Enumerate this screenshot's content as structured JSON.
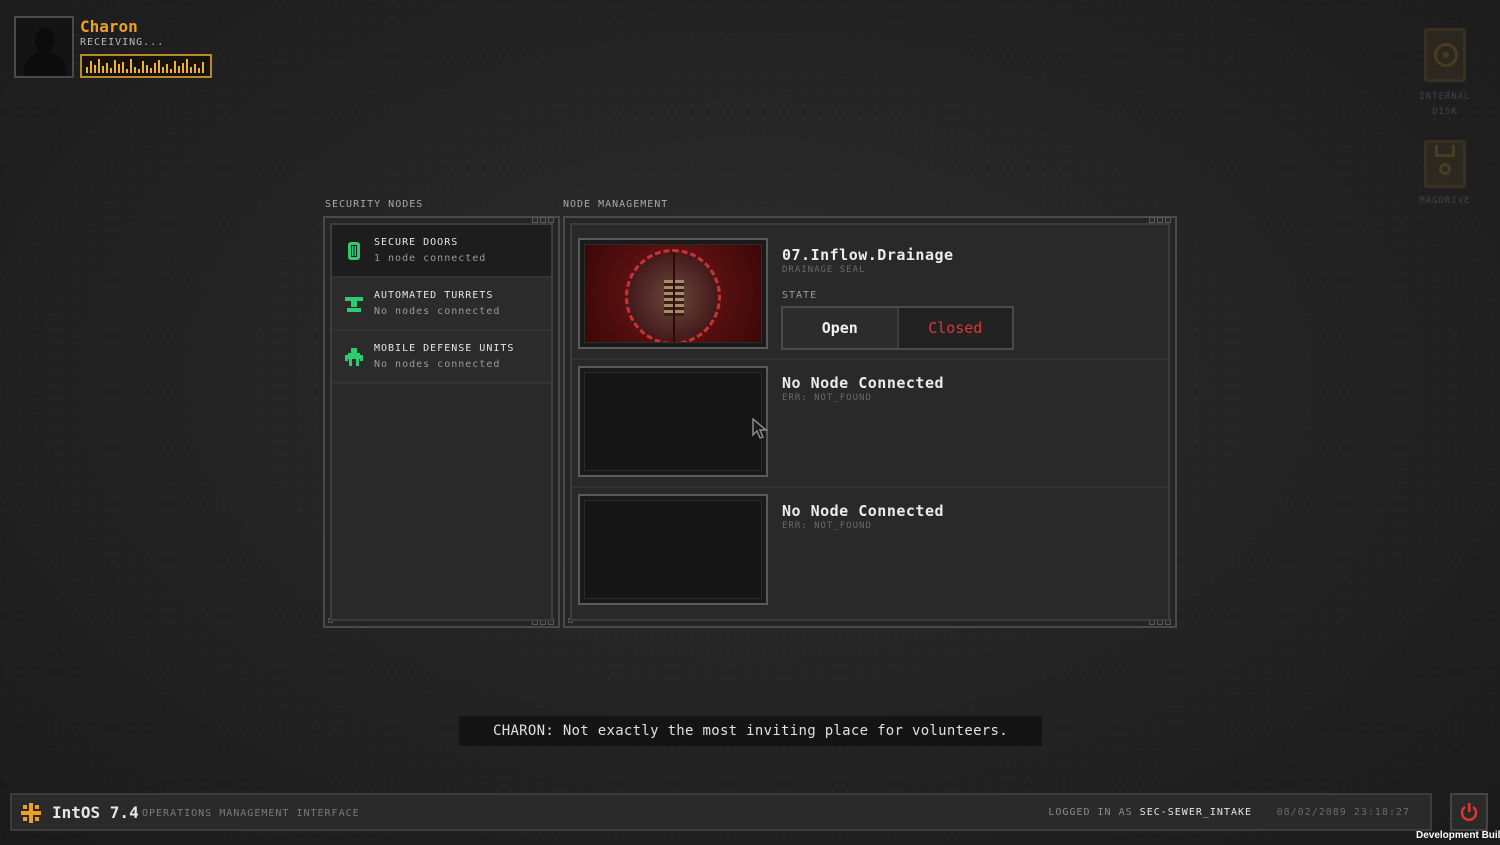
{
  "caller": {
    "name": "Charon",
    "status": "RECEIVING..."
  },
  "desktop_icons": [
    {
      "label_line1": "INTERNAL",
      "label_line2": "DISK",
      "icon": "internal-disk-icon"
    },
    {
      "label_line1": "MAGDRIVE",
      "label_line2": "",
      "icon": "magdrive-icon"
    }
  ],
  "security_nodes": {
    "caption": "SECURITY NODES",
    "items": [
      {
        "title": "SECURE DOORS",
        "subtitle": "1 node connected",
        "icon": "secure-door-icon"
      },
      {
        "title": "AUTOMATED TURRETS",
        "subtitle": "No nodes connected",
        "icon": "turret-icon"
      },
      {
        "title": "MOBILE DEFENSE UNITS",
        "subtitle": "No nodes connected",
        "icon": "mobile-unit-icon"
      }
    ]
  },
  "node_management": {
    "caption": "NODE MANAGEMENT",
    "nodes": [
      {
        "title": "07.Inflow.Drainage",
        "subtitle": "DRAINAGE SEAL",
        "state_label": "STATE",
        "open_label": "Open",
        "closed_label": "Closed"
      },
      {
        "title": "No Node Connected",
        "subtitle": "ERR: NOT_FOUND"
      },
      {
        "title": "No Node Connected",
        "subtitle": "ERR: NOT_FOUND"
      }
    ]
  },
  "dialogue": "CHARON: Not exactly the most inviting place for volunteers.",
  "taskbar": {
    "os_name": "IntOS 7.4",
    "os_desc": "OPERATIONS MANAGEMENT INTERFACE",
    "logged_in_prefix": "LOGGED IN AS",
    "user": "SEC-SEWER_INTAKE",
    "datetime": "08/02/2089 23:18:27"
  },
  "watermark": "Development Build",
  "colors": {
    "accent": "#f0a020",
    "danger": "#e23434",
    "node_green": "#2ecc71"
  }
}
